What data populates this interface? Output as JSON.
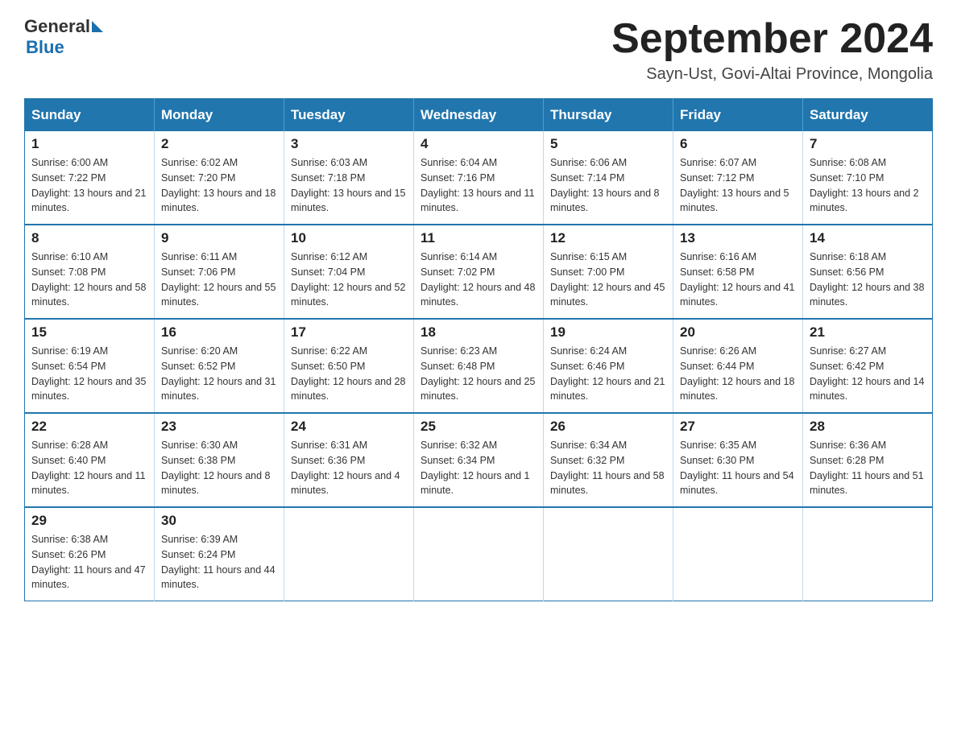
{
  "header": {
    "logo_text_general": "General",
    "logo_text_blue": "Blue",
    "month": "September 2024",
    "location": "Sayn-Ust, Govi-Altai Province, Mongolia"
  },
  "days_of_week": [
    "Sunday",
    "Monday",
    "Tuesday",
    "Wednesday",
    "Thursday",
    "Friday",
    "Saturday"
  ],
  "weeks": [
    [
      {
        "day": "1",
        "sunrise": "Sunrise: 6:00 AM",
        "sunset": "Sunset: 7:22 PM",
        "daylight": "Daylight: 13 hours and 21 minutes."
      },
      {
        "day": "2",
        "sunrise": "Sunrise: 6:02 AM",
        "sunset": "Sunset: 7:20 PM",
        "daylight": "Daylight: 13 hours and 18 minutes."
      },
      {
        "day": "3",
        "sunrise": "Sunrise: 6:03 AM",
        "sunset": "Sunset: 7:18 PM",
        "daylight": "Daylight: 13 hours and 15 minutes."
      },
      {
        "day": "4",
        "sunrise": "Sunrise: 6:04 AM",
        "sunset": "Sunset: 7:16 PM",
        "daylight": "Daylight: 13 hours and 11 minutes."
      },
      {
        "day": "5",
        "sunrise": "Sunrise: 6:06 AM",
        "sunset": "Sunset: 7:14 PM",
        "daylight": "Daylight: 13 hours and 8 minutes."
      },
      {
        "day": "6",
        "sunrise": "Sunrise: 6:07 AM",
        "sunset": "Sunset: 7:12 PM",
        "daylight": "Daylight: 13 hours and 5 minutes."
      },
      {
        "day": "7",
        "sunrise": "Sunrise: 6:08 AM",
        "sunset": "Sunset: 7:10 PM",
        "daylight": "Daylight: 13 hours and 2 minutes."
      }
    ],
    [
      {
        "day": "8",
        "sunrise": "Sunrise: 6:10 AM",
        "sunset": "Sunset: 7:08 PM",
        "daylight": "Daylight: 12 hours and 58 minutes."
      },
      {
        "day": "9",
        "sunrise": "Sunrise: 6:11 AM",
        "sunset": "Sunset: 7:06 PM",
        "daylight": "Daylight: 12 hours and 55 minutes."
      },
      {
        "day": "10",
        "sunrise": "Sunrise: 6:12 AM",
        "sunset": "Sunset: 7:04 PM",
        "daylight": "Daylight: 12 hours and 52 minutes."
      },
      {
        "day": "11",
        "sunrise": "Sunrise: 6:14 AM",
        "sunset": "Sunset: 7:02 PM",
        "daylight": "Daylight: 12 hours and 48 minutes."
      },
      {
        "day": "12",
        "sunrise": "Sunrise: 6:15 AM",
        "sunset": "Sunset: 7:00 PM",
        "daylight": "Daylight: 12 hours and 45 minutes."
      },
      {
        "day": "13",
        "sunrise": "Sunrise: 6:16 AM",
        "sunset": "Sunset: 6:58 PM",
        "daylight": "Daylight: 12 hours and 41 minutes."
      },
      {
        "day": "14",
        "sunrise": "Sunrise: 6:18 AM",
        "sunset": "Sunset: 6:56 PM",
        "daylight": "Daylight: 12 hours and 38 minutes."
      }
    ],
    [
      {
        "day": "15",
        "sunrise": "Sunrise: 6:19 AM",
        "sunset": "Sunset: 6:54 PM",
        "daylight": "Daylight: 12 hours and 35 minutes."
      },
      {
        "day": "16",
        "sunrise": "Sunrise: 6:20 AM",
        "sunset": "Sunset: 6:52 PM",
        "daylight": "Daylight: 12 hours and 31 minutes."
      },
      {
        "day": "17",
        "sunrise": "Sunrise: 6:22 AM",
        "sunset": "Sunset: 6:50 PM",
        "daylight": "Daylight: 12 hours and 28 minutes."
      },
      {
        "day": "18",
        "sunrise": "Sunrise: 6:23 AM",
        "sunset": "Sunset: 6:48 PM",
        "daylight": "Daylight: 12 hours and 25 minutes."
      },
      {
        "day": "19",
        "sunrise": "Sunrise: 6:24 AM",
        "sunset": "Sunset: 6:46 PM",
        "daylight": "Daylight: 12 hours and 21 minutes."
      },
      {
        "day": "20",
        "sunrise": "Sunrise: 6:26 AM",
        "sunset": "Sunset: 6:44 PM",
        "daylight": "Daylight: 12 hours and 18 minutes."
      },
      {
        "day": "21",
        "sunrise": "Sunrise: 6:27 AM",
        "sunset": "Sunset: 6:42 PM",
        "daylight": "Daylight: 12 hours and 14 minutes."
      }
    ],
    [
      {
        "day": "22",
        "sunrise": "Sunrise: 6:28 AM",
        "sunset": "Sunset: 6:40 PM",
        "daylight": "Daylight: 12 hours and 11 minutes."
      },
      {
        "day": "23",
        "sunrise": "Sunrise: 6:30 AM",
        "sunset": "Sunset: 6:38 PM",
        "daylight": "Daylight: 12 hours and 8 minutes."
      },
      {
        "day": "24",
        "sunrise": "Sunrise: 6:31 AM",
        "sunset": "Sunset: 6:36 PM",
        "daylight": "Daylight: 12 hours and 4 minutes."
      },
      {
        "day": "25",
        "sunrise": "Sunrise: 6:32 AM",
        "sunset": "Sunset: 6:34 PM",
        "daylight": "Daylight: 12 hours and 1 minute."
      },
      {
        "day": "26",
        "sunrise": "Sunrise: 6:34 AM",
        "sunset": "Sunset: 6:32 PM",
        "daylight": "Daylight: 11 hours and 58 minutes."
      },
      {
        "day": "27",
        "sunrise": "Sunrise: 6:35 AM",
        "sunset": "Sunset: 6:30 PM",
        "daylight": "Daylight: 11 hours and 54 minutes."
      },
      {
        "day": "28",
        "sunrise": "Sunrise: 6:36 AM",
        "sunset": "Sunset: 6:28 PM",
        "daylight": "Daylight: 11 hours and 51 minutes."
      }
    ],
    [
      {
        "day": "29",
        "sunrise": "Sunrise: 6:38 AM",
        "sunset": "Sunset: 6:26 PM",
        "daylight": "Daylight: 11 hours and 47 minutes."
      },
      {
        "day": "30",
        "sunrise": "Sunrise: 6:39 AM",
        "sunset": "Sunset: 6:24 PM",
        "daylight": "Daylight: 11 hours and 44 minutes."
      },
      null,
      null,
      null,
      null,
      null
    ]
  ]
}
